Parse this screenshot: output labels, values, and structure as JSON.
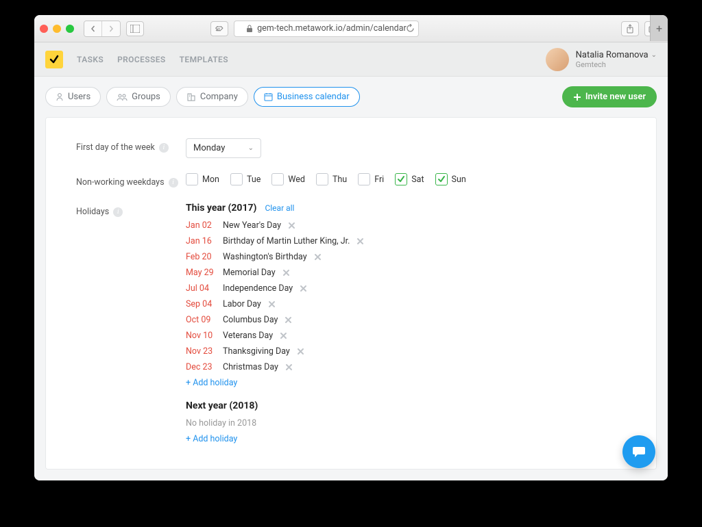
{
  "browser": {
    "url": "gem-tech.metawork.io/admin/calendar"
  },
  "header": {
    "tabs": [
      "TASKS",
      "PROCESSES",
      "TEMPLATES"
    ],
    "user": {
      "name": "Natalia Romanova",
      "company": "Gemtech"
    }
  },
  "toolbar": {
    "tabs": [
      {
        "label": "Users"
      },
      {
        "label": "Groups"
      },
      {
        "label": "Company"
      },
      {
        "label": "Business calendar",
        "active": true
      }
    ],
    "invite_label": "Invite new user"
  },
  "form": {
    "first_day_label": "First day of the week",
    "first_day_value": "Monday",
    "nonworking_label": "Non-working weekdays",
    "weekdays": [
      {
        "label": "Mon",
        "checked": false
      },
      {
        "label": "Tue",
        "checked": false
      },
      {
        "label": "Wed",
        "checked": false
      },
      {
        "label": "Thu",
        "checked": false
      },
      {
        "label": "Fri",
        "checked": false
      },
      {
        "label": "Sat",
        "checked": true
      },
      {
        "label": "Sun",
        "checked": true
      }
    ],
    "holidays_label": "Holidays",
    "this_year_label": "This year (2017)",
    "clear_all_label": "Clear all",
    "holidays_this": [
      {
        "date": "Jan 02",
        "name": "New Year's Day"
      },
      {
        "date": "Jan 16",
        "name": "Birthday of Martin Luther King, Jr."
      },
      {
        "date": "Feb 20",
        "name": "Washington's Birthday"
      },
      {
        "date": "May 29",
        "name": "Memorial Day"
      },
      {
        "date": "Jul 04",
        "name": "Independence Day"
      },
      {
        "date": "Sep 04",
        "name": "Labor Day"
      },
      {
        "date": "Oct 09",
        "name": "Columbus Day"
      },
      {
        "date": "Nov 10",
        "name": "Veterans Day"
      },
      {
        "date": "Nov 23",
        "name": "Thanksgiving Day"
      },
      {
        "date": "Dec 23",
        "name": "Christmas Day"
      }
    ],
    "add_holiday_label": "+ Add holiday",
    "next_year_label": "Next year (2018)",
    "next_year_empty": "No holiday in 2018"
  }
}
